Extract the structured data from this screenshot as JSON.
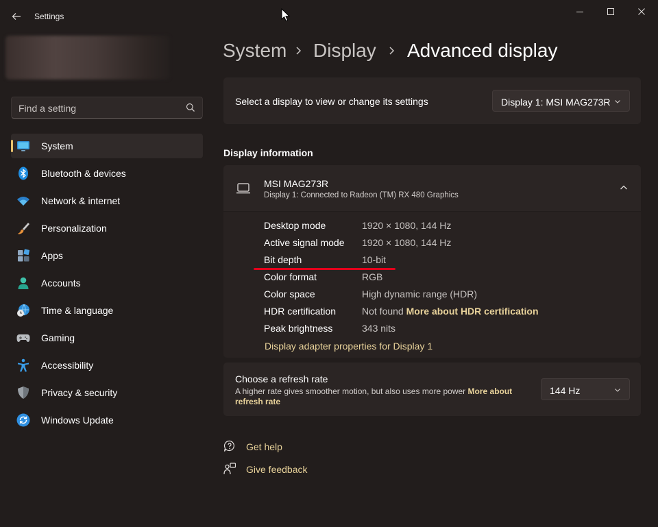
{
  "window": {
    "title": "Settings"
  },
  "search": {
    "placeholder": "Find a setting"
  },
  "sidebar": {
    "items": [
      {
        "label": "System",
        "icon": "monitor-icon",
        "selected": true
      },
      {
        "label": "Bluetooth & devices",
        "icon": "bluetooth-icon"
      },
      {
        "label": "Network & internet",
        "icon": "wifi-icon"
      },
      {
        "label": "Personalization",
        "icon": "brush-icon"
      },
      {
        "label": "Apps",
        "icon": "apps-icon"
      },
      {
        "label": "Accounts",
        "icon": "person-icon"
      },
      {
        "label": "Time & language",
        "icon": "globe-clock-icon"
      },
      {
        "label": "Gaming",
        "icon": "gamepad-icon"
      },
      {
        "label": "Accessibility",
        "icon": "accessibility-icon"
      },
      {
        "label": "Privacy & security",
        "icon": "shield-icon"
      },
      {
        "label": "Windows Update",
        "icon": "update-icon"
      }
    ]
  },
  "breadcrumb": [
    "System",
    "Display",
    "Advanced display"
  ],
  "display_select": {
    "label": "Select a display to view or change its settings",
    "value": "Display 1: MSI MAG273R"
  },
  "display_info": {
    "section_title": "Display information",
    "monitor_name": "MSI MAG273R",
    "monitor_subtitle": "Display 1: Connected to Radeon (TM) RX 480 Graphics",
    "rows": [
      {
        "label": "Desktop mode",
        "value": "1920 × 1080, 144 Hz"
      },
      {
        "label": "Active signal mode",
        "value": "1920 × 1080, 144 Hz"
      },
      {
        "label": "Bit depth",
        "value": "10-bit"
      },
      {
        "label": "Color format",
        "value": "RGB"
      },
      {
        "label": "Color space",
        "value": "High dynamic range (HDR)"
      },
      {
        "label": "HDR certification",
        "value": "Not found",
        "link": "More about HDR certification"
      },
      {
        "label": "Peak brightness",
        "value": "343 nits"
      }
    ],
    "adapter_link": "Display adapter properties for Display 1"
  },
  "refresh": {
    "title": "Choose a refresh rate",
    "description": "A higher rate gives smoother motion, but also uses more power",
    "link": "More about refresh rate",
    "value": "144 Hz"
  },
  "help": {
    "get_help": "Get help",
    "give_feedback": "Give feedback"
  },
  "colors": {
    "background": "#221d1c",
    "card": "#2b2524",
    "accent": "#e8c16c",
    "link": "#e8d29a",
    "annotation": "#e3001b"
  }
}
